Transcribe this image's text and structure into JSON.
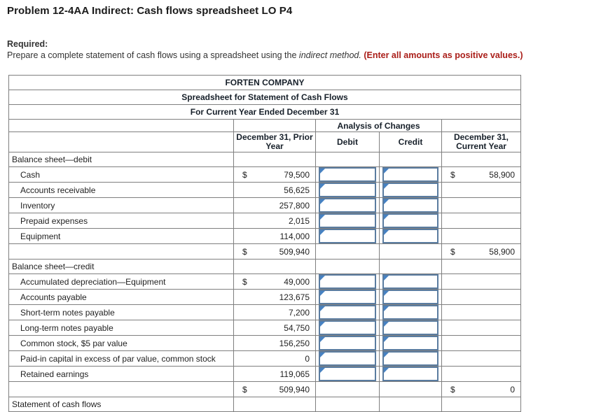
{
  "page": {
    "title": "Problem 12-4AA Indirect: Cash flows spreadsheet LO P4",
    "required_label": "Required:",
    "instructions_prefix": "Prepare a complete statement of cash flows using a spreadsheet using the ",
    "instructions_italic": "indirect method.",
    "instructions_emphasis": " (Enter all amounts as positive values.)"
  },
  "colors": {
    "header_blue": "#74a9dc",
    "gridline_gray": "#7f7f7f",
    "input_border_blue": "#5a7ca0",
    "input_marker_blue": "#4682c3",
    "total_underline_black": "#000000",
    "instruction_red": "#aa1e19"
  },
  "table": {
    "title_rows": [
      "FORTEN COMPANY",
      "Spreadsheet for Statement of Cash Flows",
      "For Current Year Ended December 31"
    ],
    "analysis_header": "Analysis of Changes",
    "columns": [
      "December 31, Prior Year",
      "Debit",
      "Credit",
      "December 31, Current Year"
    ],
    "input_default_value": "",
    "rows": [
      {
        "type": "section",
        "label": "Balance sheet—debit"
      },
      {
        "type": "item",
        "label": "Cash",
        "prior_dollar": "$",
        "prior": "79,500",
        "inputs": true,
        "current_dollar": "$",
        "current": "58,900"
      },
      {
        "type": "item",
        "label": "Accounts receivable",
        "prior": "56,625",
        "inputs": true
      },
      {
        "type": "item",
        "label": "Inventory",
        "prior": "257,800",
        "inputs": true
      },
      {
        "type": "item",
        "label": "Prepaid expenses",
        "prior": "2,015",
        "inputs": true
      },
      {
        "type": "item",
        "label": "Equipment",
        "prior": "114,000",
        "inputs": true
      },
      {
        "type": "total",
        "prior_dollar": "$",
        "prior": "509,940",
        "current_dollar": "$",
        "current": "58,900"
      },
      {
        "type": "section",
        "label": "Balance sheet—credit"
      },
      {
        "type": "item",
        "label": "Accumulated depreciation—Equipment",
        "prior_dollar": "$",
        "prior": "49,000",
        "inputs": true
      },
      {
        "type": "item",
        "label": "Accounts payable",
        "prior": "123,675",
        "inputs": true
      },
      {
        "type": "item",
        "label": "Short-term notes payable",
        "prior": "7,200",
        "inputs": true
      },
      {
        "type": "item",
        "label": "Long-term notes payable",
        "prior": "54,750",
        "inputs": true
      },
      {
        "type": "item",
        "label": "Common stock, $5 par value",
        "prior": "156,250",
        "inputs": true
      },
      {
        "type": "item",
        "label": "Paid-in capital in excess of par value, common stock",
        "prior": "0",
        "inputs": true
      },
      {
        "type": "item",
        "label": "Retained earnings",
        "prior": "119,065",
        "inputs": true
      },
      {
        "type": "total",
        "prior_dollar": "$",
        "prior": "509,940",
        "current_dollar": "$",
        "current": "0"
      },
      {
        "type": "section",
        "label": "Statement of cash flows"
      }
    ]
  }
}
